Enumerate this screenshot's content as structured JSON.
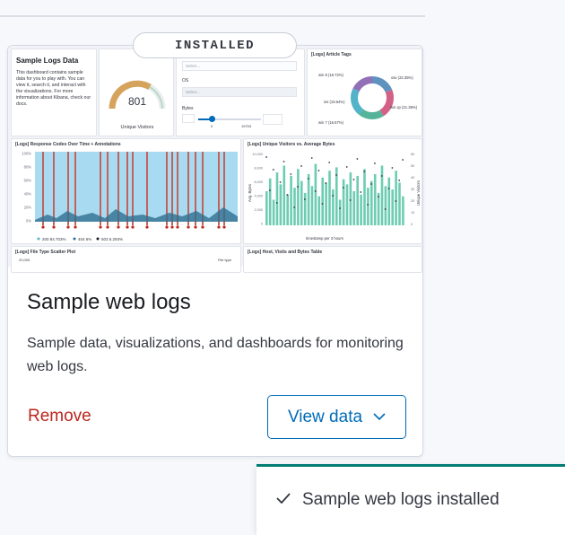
{
  "badge": "INSTALLED",
  "preview": {
    "markdown": {
      "heading": "Sample Logs Data",
      "body": "This dashboard contains sample data for you to play with. You can view it, search it, and interact with the visualizations. For more information about Kibana, check our docs."
    },
    "gauge": {
      "value": "801",
      "label": "Unique Visitors"
    },
    "controls": {
      "select_placeholder": "Select...",
      "os_label": "OS",
      "os_placeholder": "Select...",
      "bytes_label": "Bytes",
      "bytes_min": "0",
      "bytes_max": "19703"
    },
    "tags": {
      "title": "[Logs] Article Tags",
      "slices": [
        {
          "label": "win 8 (18.72%)",
          "value": 18.72,
          "color": "#6092c0"
        },
        {
          "label": "osx (22.35%)",
          "value": 22.35,
          "color": "#d36086"
        },
        {
          "label": "ios (19.64%)",
          "value": 19.64,
          "color": "#9170b8"
        },
        {
          "label": "win xp (21.38%)",
          "value": 21.38,
          "color": "#ca8eae"
        },
        {
          "label": "win 7 (16.67%)",
          "value": 16.67,
          "color": "#54b399"
        }
      ]
    },
    "response": {
      "title": "[Logs] Response Codes Over Time + Annotations",
      "yticks": [
        "100%",
        "80%",
        "60%",
        "40%",
        "20%",
        "0%"
      ],
      "legend": [
        "200 84.703%",
        "404 6%",
        "503 5.293%"
      ]
    },
    "visitors": {
      "title": "[Logs] Unique Visitors vs. Average Bytes",
      "yticks_left": [
        "10,000",
        "8,000",
        "6,000",
        "4,000",
        "2,000",
        "0"
      ],
      "yticks_right": [
        "60",
        "50",
        "40",
        "30",
        "20",
        "10",
        "0"
      ],
      "xlabel": "timestamp per 3 hours",
      "ylabel_left": "Avg. Bytes",
      "ylabel_right": "Unique Visitors"
    },
    "scatter": {
      "title": "[Logs] File Type Scatter Plot",
      "ytick": "20,000",
      "legend": "File type"
    },
    "table": {
      "title": "[Logs] Host, Visits and Bytes Table"
    }
  },
  "card": {
    "title": "Sample web logs",
    "description": "Sample data, visualizations, and dashboards for monitoring web logs.",
    "remove_label": "Remove",
    "view_label": "View data"
  },
  "toast": {
    "message": "Sample web logs installed"
  },
  "colors": {
    "accent": "#006bb8",
    "danger": "#bd271e",
    "success": "#017d73"
  }
}
